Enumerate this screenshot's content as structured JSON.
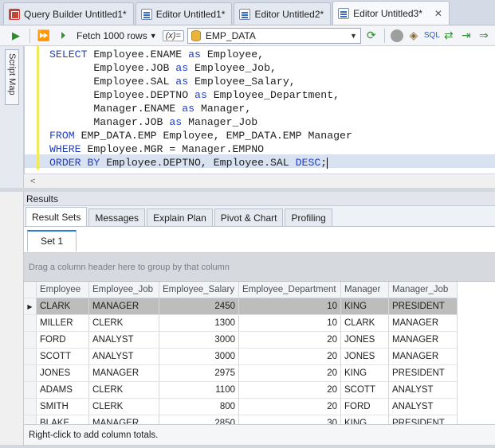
{
  "tabs": [
    {
      "label": "Query Builder Untitled1*",
      "icon": "query-builder-icon",
      "active": false
    },
    {
      "label": "Editor Untitled1*",
      "icon": "editor-icon",
      "active": false
    },
    {
      "label": "Editor Untitled2*",
      "icon": "editor-icon",
      "active": false
    },
    {
      "label": "Editor Untitled3*",
      "icon": "editor-icon",
      "active": true
    }
  ],
  "toolbar": {
    "fetch_label": "Fetch 1000 rows",
    "variables_label": "(x)=",
    "connection": "EMP_DATA"
  },
  "script_map_label": "Script Map",
  "sql_lines": [
    [
      {
        "t": "SELECT",
        "k": true
      },
      {
        "t": " Employee.ENAME ",
        "k": false
      },
      {
        "t": "as",
        "k": true
      },
      {
        "t": " Employee,",
        "k": false
      }
    ],
    [
      {
        "t": "       Employee.JOB ",
        "k": false
      },
      {
        "t": "as",
        "k": true
      },
      {
        "t": " Employee_Job,",
        "k": false
      }
    ],
    [
      {
        "t": "       Employee.SAL ",
        "k": false
      },
      {
        "t": "as",
        "k": true
      },
      {
        "t": " Employee_Salary,",
        "k": false
      }
    ],
    [
      {
        "t": "       Employee.DEPTNO ",
        "k": false
      },
      {
        "t": "as",
        "k": true
      },
      {
        "t": " Employee_Department,",
        "k": false
      }
    ],
    [
      {
        "t": "       Manager.ENAME ",
        "k": false
      },
      {
        "t": "as",
        "k": true
      },
      {
        "t": " Manager,",
        "k": false
      }
    ],
    [
      {
        "t": "       Manager.JOB ",
        "k": false
      },
      {
        "t": "as",
        "k": true
      },
      {
        "t": " Manager_Job",
        "k": false
      }
    ],
    [
      {
        "t": "FROM",
        "k": true
      },
      {
        "t": " EMP_DATA.EMP Employee, EMP_DATA.EMP Manager",
        "k": false
      }
    ],
    [
      {
        "t": "WHERE",
        "k": true
      },
      {
        "t": " Employee.MGR = Manager.EMPNO",
        "k": false
      }
    ],
    [
      {
        "t": "ORDER BY",
        "k": true
      },
      {
        "t": " Employee.DEPTNO, Employee.SAL ",
        "k": false
      },
      {
        "t": "DESC",
        "k": true
      },
      {
        "t": ";",
        "k": false
      }
    ]
  ],
  "results": {
    "header": "Results",
    "tabs": [
      "Result Sets",
      "Messages",
      "Explain Plan",
      "Pivot & Chart",
      "Profiling"
    ],
    "set_tab": "Set 1",
    "group_hint": "Drag a column header here to group by that column",
    "columns": [
      "Employee",
      "Employee_Job",
      "Employee_Salary",
      "Employee_Department",
      "Manager",
      "Manager_Job"
    ],
    "rows": [
      [
        "CLARK",
        "MANAGER",
        "2450",
        "10",
        "KING",
        "PRESIDENT"
      ],
      [
        "MILLER",
        "CLERK",
        "1300",
        "10",
        "CLARK",
        "MANAGER"
      ],
      [
        "FORD",
        "ANALYST",
        "3000",
        "20",
        "JONES",
        "MANAGER"
      ],
      [
        "SCOTT",
        "ANALYST",
        "3000",
        "20",
        "JONES",
        "MANAGER"
      ],
      [
        "JONES",
        "MANAGER",
        "2975",
        "20",
        "KING",
        "PRESIDENT"
      ],
      [
        "ADAMS",
        "CLERK",
        "1100",
        "20",
        "SCOTT",
        "ANALYST"
      ],
      [
        "SMITH",
        "CLERK",
        "800",
        "20",
        "FORD",
        "ANALYST"
      ],
      [
        "BLAKE",
        "MANAGER",
        "2850",
        "30",
        "KING",
        "PRESIDENT"
      ]
    ],
    "status": "Right-click to add column totals."
  }
}
